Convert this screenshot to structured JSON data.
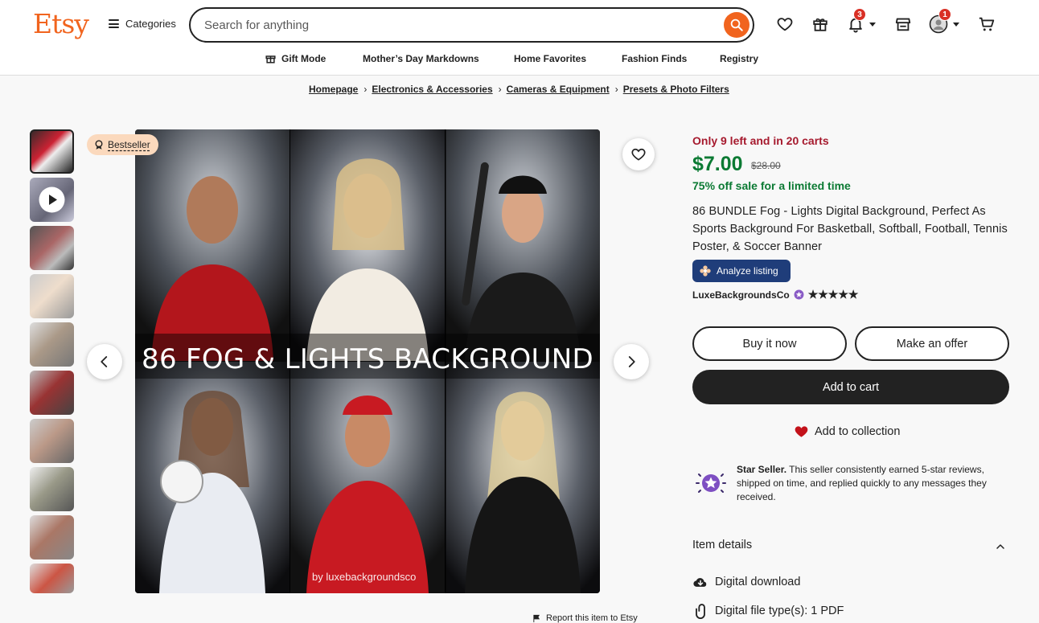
{
  "header": {
    "logo": "Etsy",
    "categories_label": "Categories",
    "search_placeholder": "Search for anything",
    "notifications_count": "3",
    "account_count": "1"
  },
  "subnav": [
    "Gift Mode",
    "Mother’s Day Markdowns",
    "Home Favorites",
    "Fashion Finds",
    "Registry"
  ],
  "breadcrumbs": [
    "Homepage",
    "Electronics & Accessories",
    "Cameras & Equipment",
    "Presets & Photo Filters"
  ],
  "gallery": {
    "bestseller_label": "Bestseller",
    "overlay_text": "86 FOG & LIGHTS BACKGROUND",
    "watermark": "by luxebackgroundsco",
    "thumb_count": 10
  },
  "listing": {
    "scarcity": "Only 9 left and in 20 carts",
    "price": "$7.00",
    "original_price": "$28.00",
    "sale_text": "75% off sale for a limited time",
    "title": "86 BUNDLE Fog - Lights Digital Background, Perfect As Sports Background For Basketball, Softball, Football, Tennis Poster, & Soccer Banner",
    "analyze_label": "Analyze listing",
    "shop_name": "LuxeBackgroundsCo",
    "rating_stars": "★★★★★",
    "buy_now": "Buy it now",
    "make_offer": "Make an offer",
    "add_to_cart": "Add to cart",
    "add_to_collection": "Add to collection",
    "star_seller_title": "Star Seller.",
    "star_seller_text": " This seller consistently earned 5-star reviews, shipped on time, and replied quickly to any messages they received.",
    "item_details": "Item details",
    "digital_download": "Digital download",
    "file_types": "Digital file type(s): 1 PDF",
    "report": "Report this item to Etsy"
  },
  "colors": {
    "brand": "#f1641e",
    "price_green": "#0b7a33",
    "scarcity_red": "#a61a2e",
    "analyze_blue": "#1f3d7a"
  }
}
